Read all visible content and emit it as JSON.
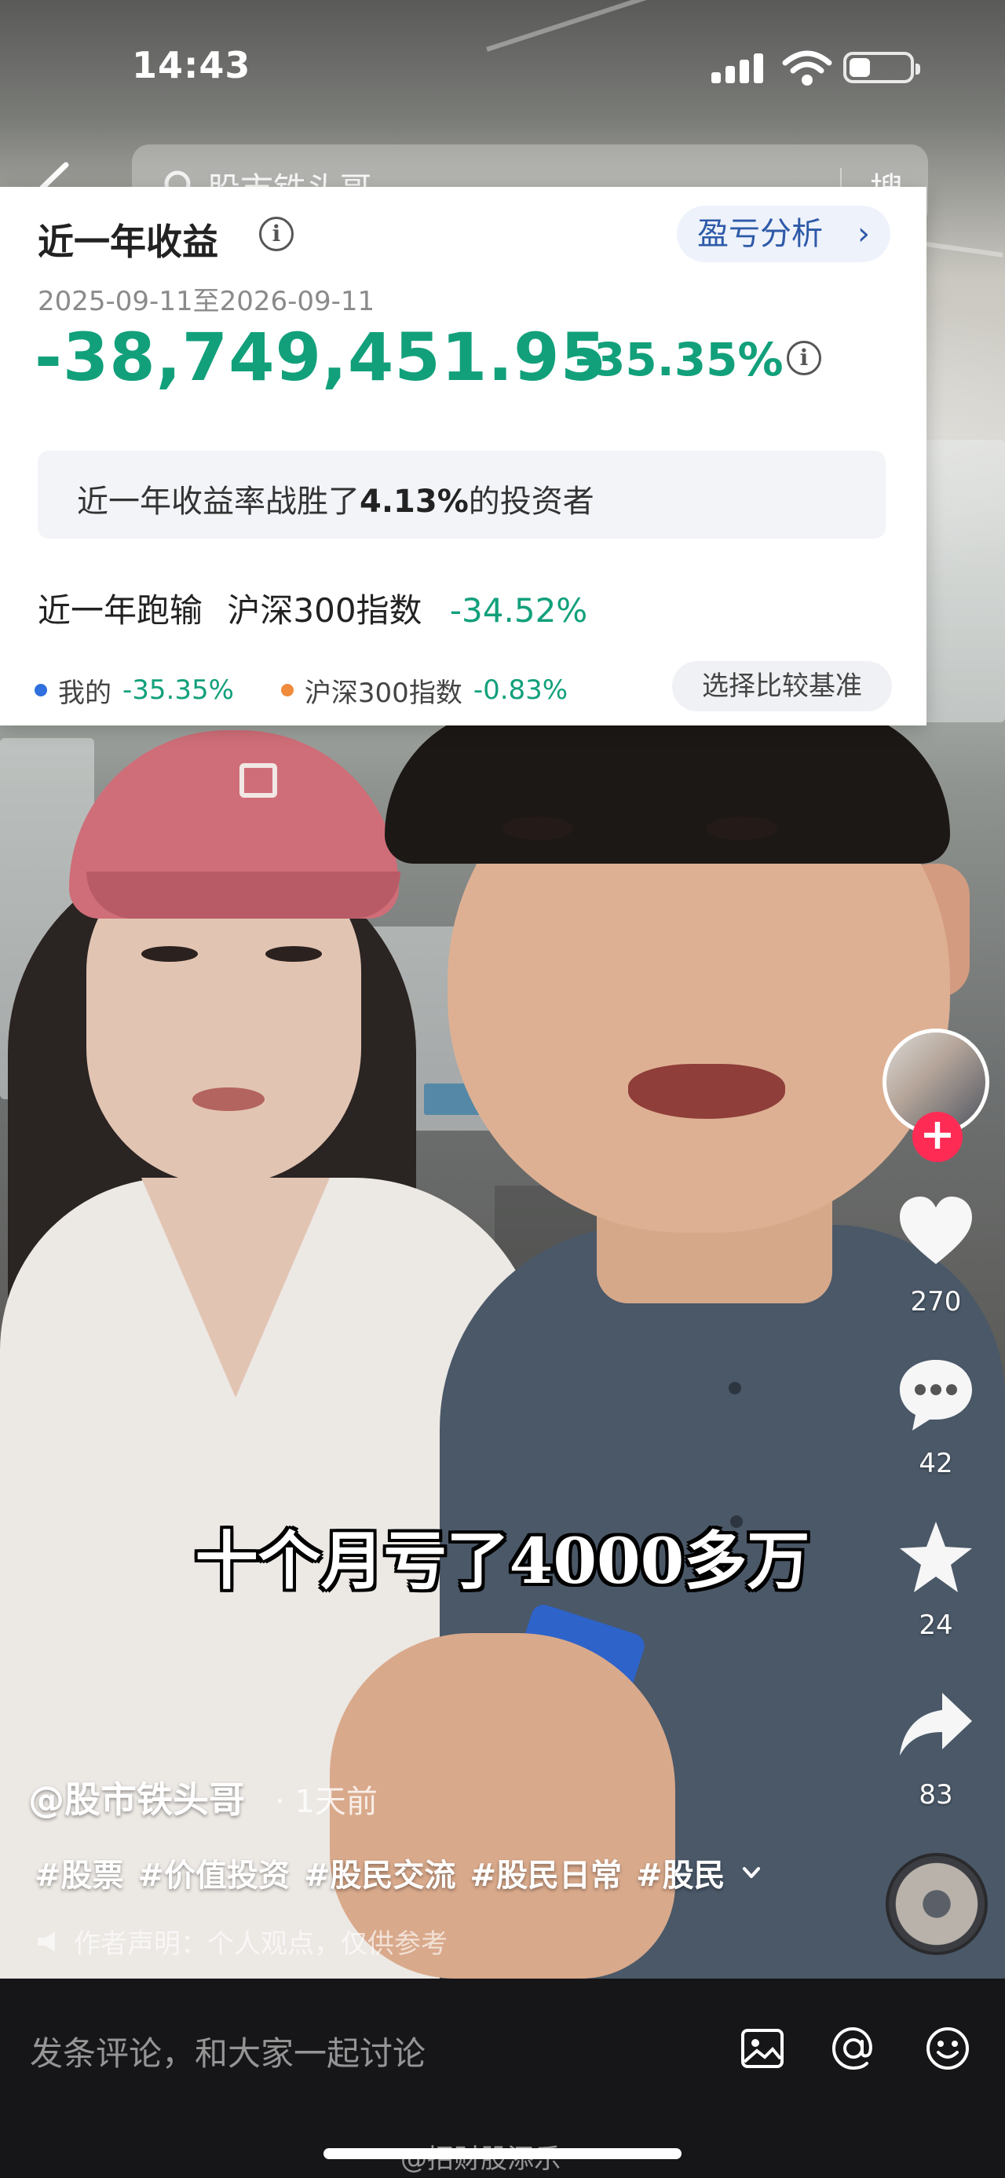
{
  "status_bar": {
    "time": "14:43",
    "battery_level": 0.35
  },
  "search": {
    "query": "股市铁头哥",
    "button_label": "搜索"
  },
  "profit_card": {
    "title": "近一年收益",
    "analysis_button": "盈亏分析",
    "date_range": "2025-09-11至2026-09-11",
    "amount": "-38,749,451.95",
    "rate": "-35.35%",
    "beat_prefix": "近一年收益率战胜了",
    "beat_percent": "4.13%",
    "beat_suffix": "的投资者",
    "lag_label": "近一年跑输",
    "index_name": "沪深300指数",
    "lag_value": "-34.52%",
    "legend": [
      {
        "label": "我的",
        "value": "-35.35%",
        "color": "#2f6fde"
      },
      {
        "label": "沪深300指数",
        "value": "-0.83%",
        "color": "#f08a3c"
      }
    ],
    "compare_button": "选择比较基准"
  },
  "video": {
    "subtitle": "十个月亏了4000多万"
  },
  "right_rail": {
    "likes": "270",
    "comments": "42",
    "favorites": "24",
    "shares": "83",
    "follow_symbol": "+"
  },
  "description": {
    "username": "@股市铁头哥",
    "posted": "· 1天前",
    "hashtags": [
      "#股票",
      "#价值投资",
      "#股民交流",
      "#股民日常",
      "#股民"
    ],
    "disclaimer": "作者声明：个人观点，仅供参考"
  },
  "comment_bar": {
    "placeholder": "发条评论，和大家一起讨论"
  },
  "watermark": "@招财股添乐",
  "colors": {
    "loss_green": "#12a07b",
    "accent_red": "#fe2c55",
    "link_blue": "#2e5aa8"
  },
  "icons": [
    "back-icon",
    "search-icon",
    "info-icon",
    "chevron-right-icon",
    "heart-icon",
    "comment-icon",
    "star-icon",
    "share-icon",
    "image-icon",
    "at-icon",
    "emoji-icon"
  ]
}
